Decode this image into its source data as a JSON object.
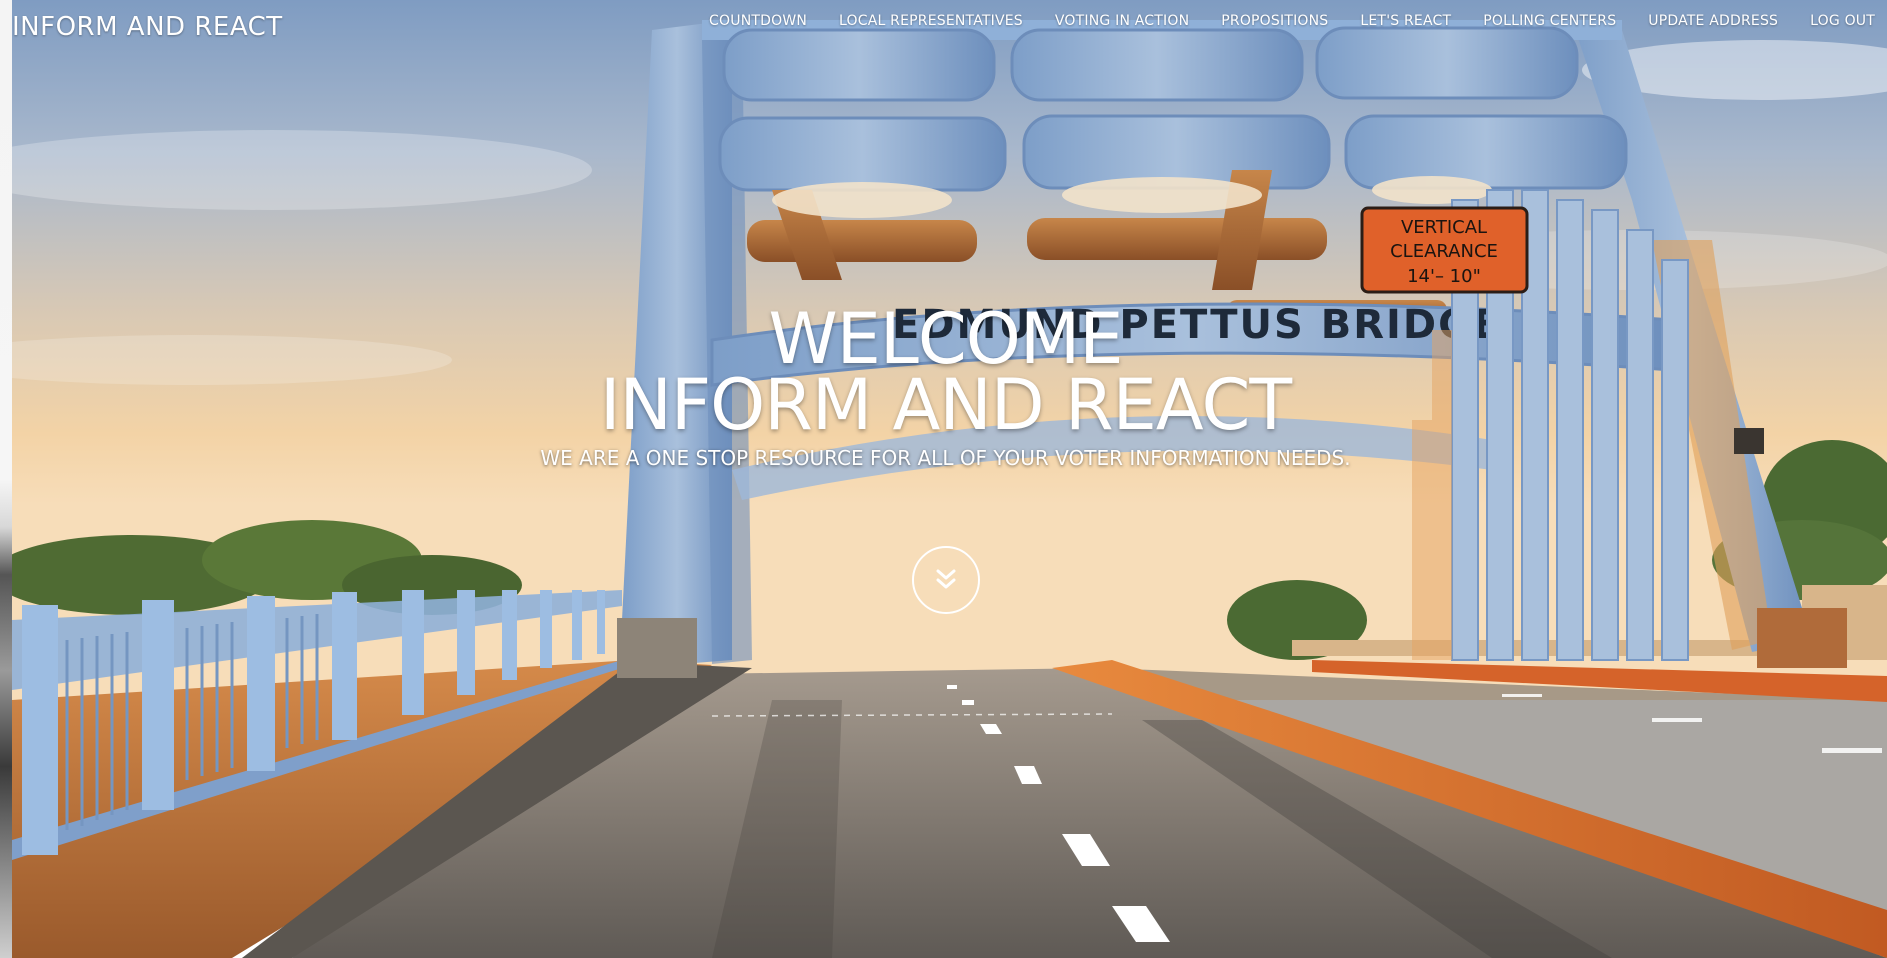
{
  "brand": {
    "name": "INFORM AND REACT"
  },
  "nav": {
    "items": [
      {
        "label": "COUNTDOWN"
      },
      {
        "label": "LOCAL REPRESENTATIVES"
      },
      {
        "label": "VOTING IN ACTION"
      },
      {
        "label": "PROPOSITIONS"
      },
      {
        "label": "LET'S REACT"
      },
      {
        "label": "POLLING CENTERS"
      },
      {
        "label": "UPDATE ADDRESS"
      },
      {
        "label": "LOG OUT"
      }
    ]
  },
  "hero": {
    "welcome": "WELCOME",
    "title": "INFORM AND REACT",
    "subtitle": "WE ARE A ONE STOP RESOURCE FOR ALL OF YOUR VOTER INFORMATION NEEDS.",
    "scroll_icon": "double-chevron-down-icon",
    "background": {
      "bridge_name": "EDMUND PETTUS BRIDGE",
      "sign_lines": [
        "VERTICAL",
        "CLEARANCE",
        "14'– 10\""
      ]
    }
  },
  "colors": {
    "text": "#ffffff",
    "bridge_steel": "#8aa9cf",
    "sign_orange": "#e0612a",
    "road": "#6e6a66",
    "sky_top": "#7c9bc2",
    "sky_glow": "#f4d3a6"
  }
}
